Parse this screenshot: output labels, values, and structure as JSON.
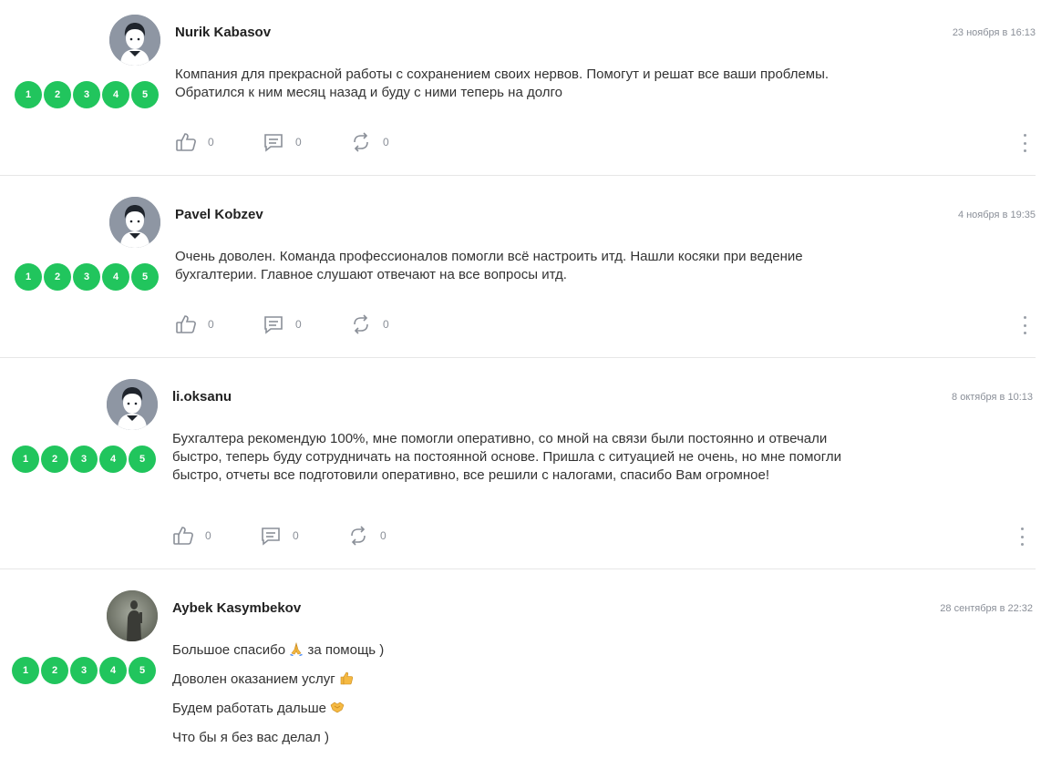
{
  "reviews": [
    {
      "author": "Nurik Kabasov",
      "date": "23 ноября в 16:13",
      "text": "Компания для прекрасной работы с сохранением своих нервов. Помогут и решат все ваши проблемы. Обратился к ним месяц назад и буду с ними теперь на долго",
      "likes": "0",
      "comments": "0",
      "reposts": "0",
      "rating": [
        "1",
        "2",
        "3",
        "4",
        "5"
      ]
    },
    {
      "author": "Pavel Kobzev",
      "date": "4 ноября в 19:35",
      "text": "Очень доволен. Команда профессионалов помогли всё настроить итд. Нашли косяки при ведение бухгалтерии. Главное слушают отвечают на все вопросы итд.",
      "likes": "0",
      "comments": "0",
      "reposts": "0",
      "rating": [
        "1",
        "2",
        "3",
        "4",
        "5"
      ]
    },
    {
      "author": "li.oksanu",
      "date": "8 октября в 10:13",
      "text": "Бухгалтера рекомендую 100%, мне помогли оперативно, со мной на связи были постоянно и отвечали быстро, теперь буду сотрудничать на постоянной основе. Пришла с ситуацией не очень, но мне помогли быстро, отчеты все подготовили оперативно, все решили с налогами, спасибо Вам огромное!",
      "likes": "0",
      "comments": "0",
      "reposts": "0",
      "rating": [
        "1",
        "2",
        "3",
        "4",
        "5"
      ]
    },
    {
      "author": "Aybek Kasymbekov",
      "date": "28 сентября в 22:32",
      "lines": [
        "Большое спасибо",
        "за помощь )",
        "Доволен оказанием услуг",
        "Будем работать дальше",
        "Что бы я без вас делал )"
      ],
      "rating": [
        "1",
        "2",
        "3",
        "4",
        "5"
      ]
    }
  ],
  "colors": {
    "rating": "#21c55d",
    "muted": "#8a8f98"
  },
  "icons": {
    "like": "thumb-up-icon",
    "comment": "comment-icon",
    "repost": "repost-icon",
    "more": "more-vertical-icon"
  }
}
